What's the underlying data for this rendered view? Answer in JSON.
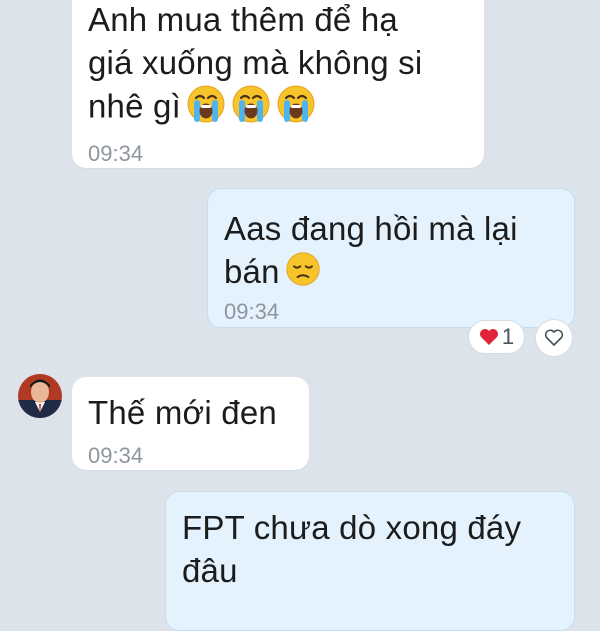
{
  "messages": [
    {
      "direction": "incoming",
      "text_lines": [
        "Anh mua thêm để hạ",
        "giá xuống mà không si",
        "nhê gì"
      ],
      "emojis": [
        "crying-face-icon",
        "crying-face-icon",
        "crying-face-icon"
      ],
      "time": "09:34"
    },
    {
      "direction": "outgoing",
      "text_lines": [
        "Aas đang hồi mà lại",
        "bán"
      ],
      "emojis": [
        "disappointed-face-icon"
      ],
      "time": "09:34",
      "reaction": {
        "icon": "heart-icon",
        "count": "1"
      }
    },
    {
      "direction": "incoming",
      "sender_avatar": "avatar",
      "text_lines": [
        "Thế mới đen"
      ],
      "time": "09:34"
    },
    {
      "direction": "outgoing",
      "text_lines": [
        "FPT chưa dò xong đáy",
        "đâu"
      ]
    }
  ],
  "colors": {
    "background": "#dde3ea",
    "incoming_bubble": "#ffffff",
    "outgoing_bubble": "#e3f2fd",
    "time_text": "#8d969f",
    "reaction_heart": "#e0243a"
  }
}
